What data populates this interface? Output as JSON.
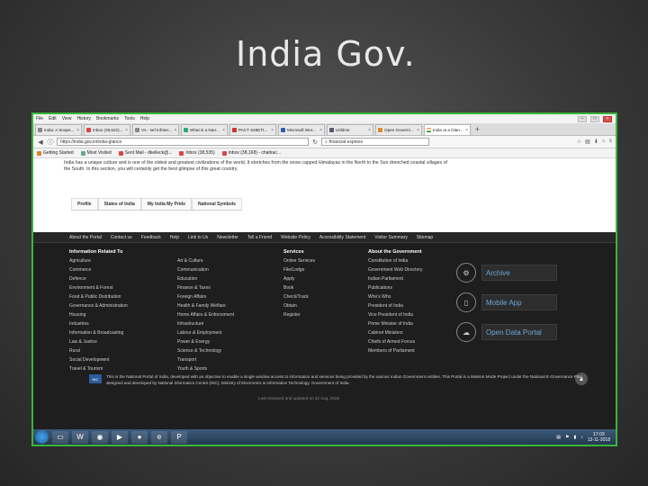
{
  "slide": {
    "title": "India Gov."
  },
  "browser": {
    "menu": [
      "File",
      "Edit",
      "View",
      "History",
      "Bookmarks",
      "Tools",
      "Help"
    ],
    "tabs": [
      {
        "label": "India: A Snaps...",
        "active": false
      },
      {
        "label": "Inbox (39,622)...",
        "active": false
      },
      {
        "label": "VA - sef Infotec...",
        "active": false
      },
      {
        "label": "What is a Narr...",
        "active": false
      },
      {
        "label": "PACT S48ETt...",
        "active": false
      },
      {
        "label": "Microsoft Wor...",
        "active": false
      },
      {
        "label": "Utildme",
        "active": false
      },
      {
        "label": "Open Governi...",
        "active": false
      },
      {
        "label": "India at a Glan...",
        "active": true
      }
    ],
    "url": "https://india.gov.in/india-glance",
    "search": "financial express",
    "bookmarks": [
      "Getting Started",
      "Most Visited",
      "Sent Mail - dkelleck@...",
      "Inbox (38,535)",
      "Inbox (38,168) - chaitrac..."
    ]
  },
  "page": {
    "intro": "India has a unique culture and is one of the oldest and greatest civilizations of the world. It stretches from the snow capped Himalayas in the North to the Sun drenched coastal villages of the South. In this section, you will certainly get the best glimpse of this great country.",
    "profile_tabs": [
      "Profile",
      "States of India",
      "My India My Pride",
      "National Symbols"
    ],
    "topnav": [
      "About the Portal",
      "Contact us",
      "Feedback",
      "Help",
      "Link to Us",
      "Newsletter",
      "Tell a Friend",
      "Website Policy",
      "Accessibility Statement",
      "Visitor Summary",
      "Sitemap"
    ],
    "info_heading": "Information Related To",
    "info_col1": [
      "Agriculture",
      "Commerce",
      "Defence",
      "Environment & Forest",
      "Food & Public Distribution",
      "Governance & Administration",
      "Housing",
      "Industries",
      "Information & Broadcasting",
      "Law & Justice",
      "Rural",
      "Social Development",
      "Travel & Tourism"
    ],
    "info_col2": [
      "Art & Culture",
      "Communication",
      "Education",
      "Finance & Taxes",
      "Foreign Affairs",
      "Health & Family Welfare",
      "Home Affairs & Enforcement",
      "Infrastructure",
      "Labour & Employment",
      "Power & Energy",
      "Science & Technology",
      "Transport",
      "Youth & Sports"
    ],
    "services_heading": "Services",
    "services": [
      "Online Services",
      "File/Lodge",
      "Apply",
      "Book",
      "Check/Track",
      "Obtain",
      "Register"
    ],
    "govt_heading": "About the Government",
    "govt": [
      "Constitution of India",
      "Government Web Directory",
      "Indian Parliament",
      "Publications",
      "Who's Who",
      "President of India",
      "Vice President of India",
      "Prime Minister of India",
      "Cabinet Ministers",
      "Chiefs of Armed Forces",
      "Members of Parliament"
    ],
    "promos": [
      {
        "label": "Archive",
        "icon": "archive-icon"
      },
      {
        "label": "Mobile App",
        "icon": "mobile-icon"
      },
      {
        "label": "Open Data Portal",
        "icon": "cloud-icon"
      }
    ],
    "nic_logo": "NIC",
    "nic_text": "This is the National Portal of India, developed with an objective to enable a single window access to information and services being provided by the various Indian Government entities. This Portal is a Mission Mode Project under the National E-Governance Plan, designed and developed by National Informatics Centre (NIC), Ministry of Electronics & Information Technology, Government of India.",
    "updated": "Last reviewed and updated on 22 Aug, 2018"
  },
  "taskbar": {
    "time": "17:03",
    "date": "13-11-2018"
  }
}
